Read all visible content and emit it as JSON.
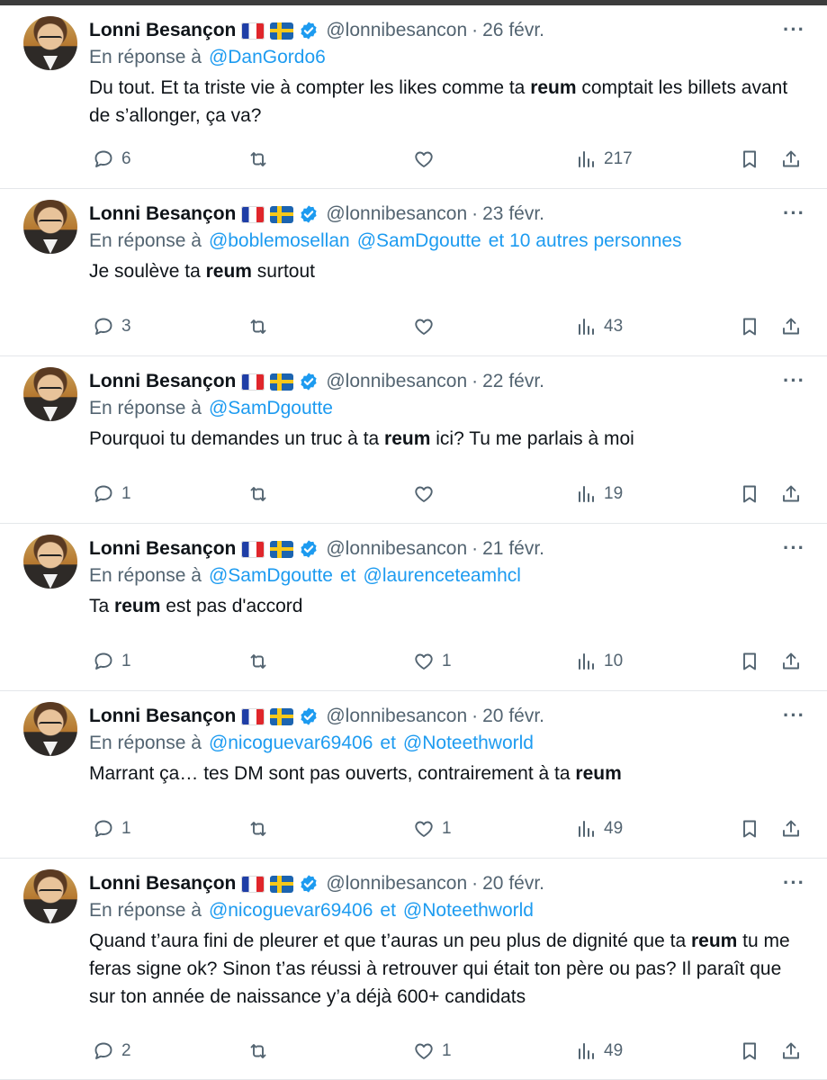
{
  "tweets": [
    {
      "author": "Lonni Besançon",
      "handle": "@lonnibesancon",
      "date": "26 févr.",
      "reply_prefix": "En réponse à",
      "mentions": [
        "@DanGordo6"
      ],
      "text_parts": [
        "Du tout. Et ta triste vie à compter les likes comme ta ",
        "reum",
        " comptait les billets avant de s’allonger, ça va?"
      ],
      "replies": "6",
      "retweets": "",
      "likes": "",
      "views": "217"
    },
    {
      "author": "Lonni Besançon",
      "handle": "@lonnibesancon",
      "date": "23 févr.",
      "reply_prefix": "En réponse à",
      "mentions": [
        "@boblemosellan",
        "@SamDgoutte",
        "et 10 autres personnes"
      ],
      "text_parts": [
        "Je soulève ta ",
        "reum",
        " surtout"
      ],
      "replies": "3",
      "retweets": "",
      "likes": "",
      "views": "43"
    },
    {
      "author": "Lonni Besançon",
      "handle": "@lonnibesancon",
      "date": "22 févr.",
      "reply_prefix": "En réponse à",
      "mentions": [
        "@SamDgoutte"
      ],
      "text_parts": [
        "Pourquoi tu demandes un truc à ta ",
        "reum",
        " ici? Tu me parlais à moi"
      ],
      "replies": "1",
      "retweets": "",
      "likes": "",
      "views": "19"
    },
    {
      "author": "Lonni Besançon",
      "handle": "@lonnibesancon",
      "date": "21 févr.",
      "reply_prefix": "En réponse à",
      "mentions": [
        "@SamDgoutte",
        "et",
        "@laurenceteamhcl"
      ],
      "text_parts": [
        "Ta ",
        "reum",
        " est pas d'accord"
      ],
      "replies": "1",
      "retweets": "",
      "likes": "1",
      "views": "10"
    },
    {
      "author": "Lonni Besançon",
      "handle": "@lonnibesancon",
      "date": "20 févr.",
      "reply_prefix": "En réponse à",
      "mentions": [
        "@nicoguevar69406",
        "et",
        "@Noteethworld"
      ],
      "text_parts": [
        "Marrant ça… tes DM sont pas ouverts, contrairement à ta ",
        "reum",
        ""
      ],
      "replies": "1",
      "retweets": "",
      "likes": "1",
      "views": "49"
    },
    {
      "author": "Lonni Besançon",
      "handle": "@lonnibesancon",
      "date": "20 févr.",
      "reply_prefix": "En réponse à",
      "mentions": [
        "@nicoguevar69406",
        "et",
        "@Noteethworld"
      ],
      "text_parts": [
        "Quand t’aura fini de pleurer et que t’auras un peu plus de dignité que ta ",
        "reum",
        " tu me feras signe ok? Sinon t’as réussi à retrouver qui était ton père ou pas? Il paraît que sur ton année de naissance y’a déjà 600+ candidats"
      ],
      "replies": "2",
      "retweets": "",
      "likes": "1",
      "views": "49"
    }
  ],
  "icons": {
    "more": "more-dots-icon",
    "reply": "reply-bubble-icon",
    "retweet": "retweet-icon",
    "like": "heart-icon",
    "views": "views-bar-chart-icon",
    "bookmark": "bookmark-icon",
    "share": "share-upload-icon",
    "verified": "verified-badge-icon"
  },
  "colors": {
    "link": "#1d9bf0",
    "muted": "#536471",
    "text": "#0f1419",
    "divider": "#e4e7ea"
  }
}
